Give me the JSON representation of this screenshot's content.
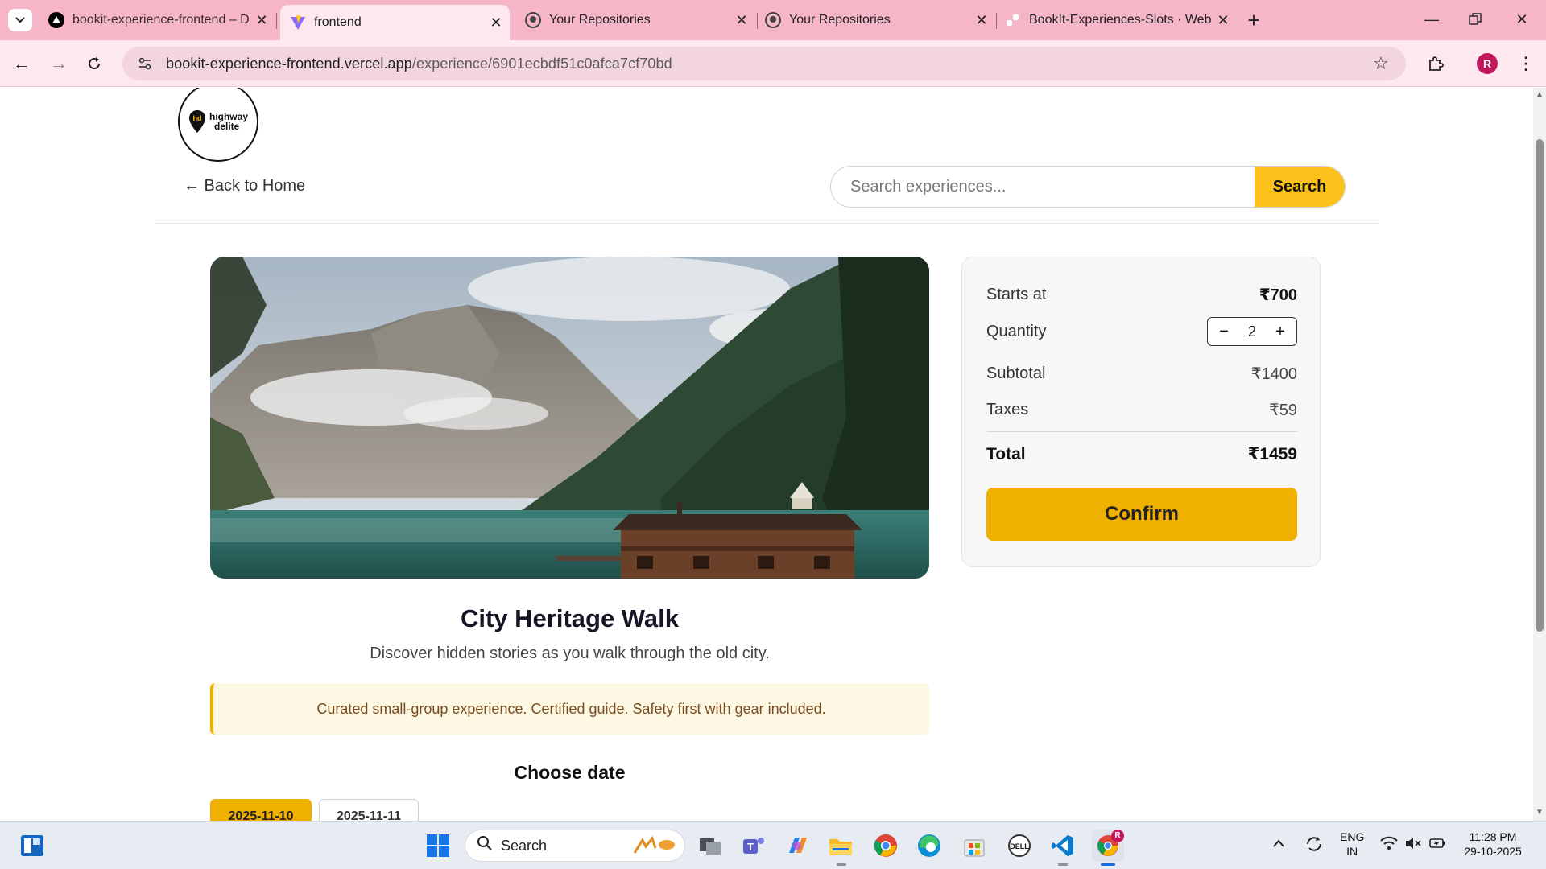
{
  "browser": {
    "tabs": [
      {
        "title": "bookit-experience-frontend – D",
        "icon": "vercel-triangle-icon",
        "active": false
      },
      {
        "title": "frontend",
        "icon": "vite-icon",
        "active": true
      },
      {
        "title": "Your Repositories",
        "icon": "github-icon",
        "active": false
      },
      {
        "title": "Your Repositories",
        "icon": "github-icon",
        "active": false
      },
      {
        "title": "BookIt-Experiences-Slots · Web",
        "icon": "render-icon",
        "active": false
      }
    ],
    "url_host": "bookit-experience-frontend.vercel.app",
    "url_path": "/experience/6901ecbdf51c0afca7cf70bd",
    "profile_initial": "R"
  },
  "header": {
    "logo_line1": "highway",
    "logo_line2": "delite",
    "logo_mark": "hd",
    "back_label": "← Back to Home",
    "search_placeholder": "Search experiences...",
    "search_button": "Search"
  },
  "experience": {
    "title": "City Heritage Walk",
    "description": "Discover hidden stories as you walk through the old city.",
    "notice": "Curated small-group experience. Certified guide. Safety first with gear included.",
    "choose_date_label": "Choose date",
    "dates": [
      "2025-11-10",
      "2025-11-11"
    ],
    "selected_date": "2025-11-10"
  },
  "booking": {
    "starts_at_label": "Starts at",
    "starts_at_value": "₹700",
    "quantity_label": "Quantity",
    "quantity_value": "2",
    "qty_minus": "−",
    "qty_plus": "+",
    "subtotal_label": "Subtotal",
    "subtotal_value": "₹1400",
    "taxes_label": "Taxes",
    "taxes_value": "₹59",
    "total_label": "Total",
    "total_value": "₹1459",
    "confirm_label": "Confirm"
  },
  "taskbar": {
    "search_label": "Search",
    "lang_line1": "ENG",
    "lang_line2": "IN",
    "time": "11:28 PM",
    "date": "29-10-2025",
    "chrome_badge": "R"
  },
  "colors": {
    "accent": "#f0b000",
    "search_button": "#fcc11a",
    "tabbar": "#f6b6c7",
    "notice_bg": "#fdf8e3",
    "notice_text": "#7a4b1e"
  }
}
